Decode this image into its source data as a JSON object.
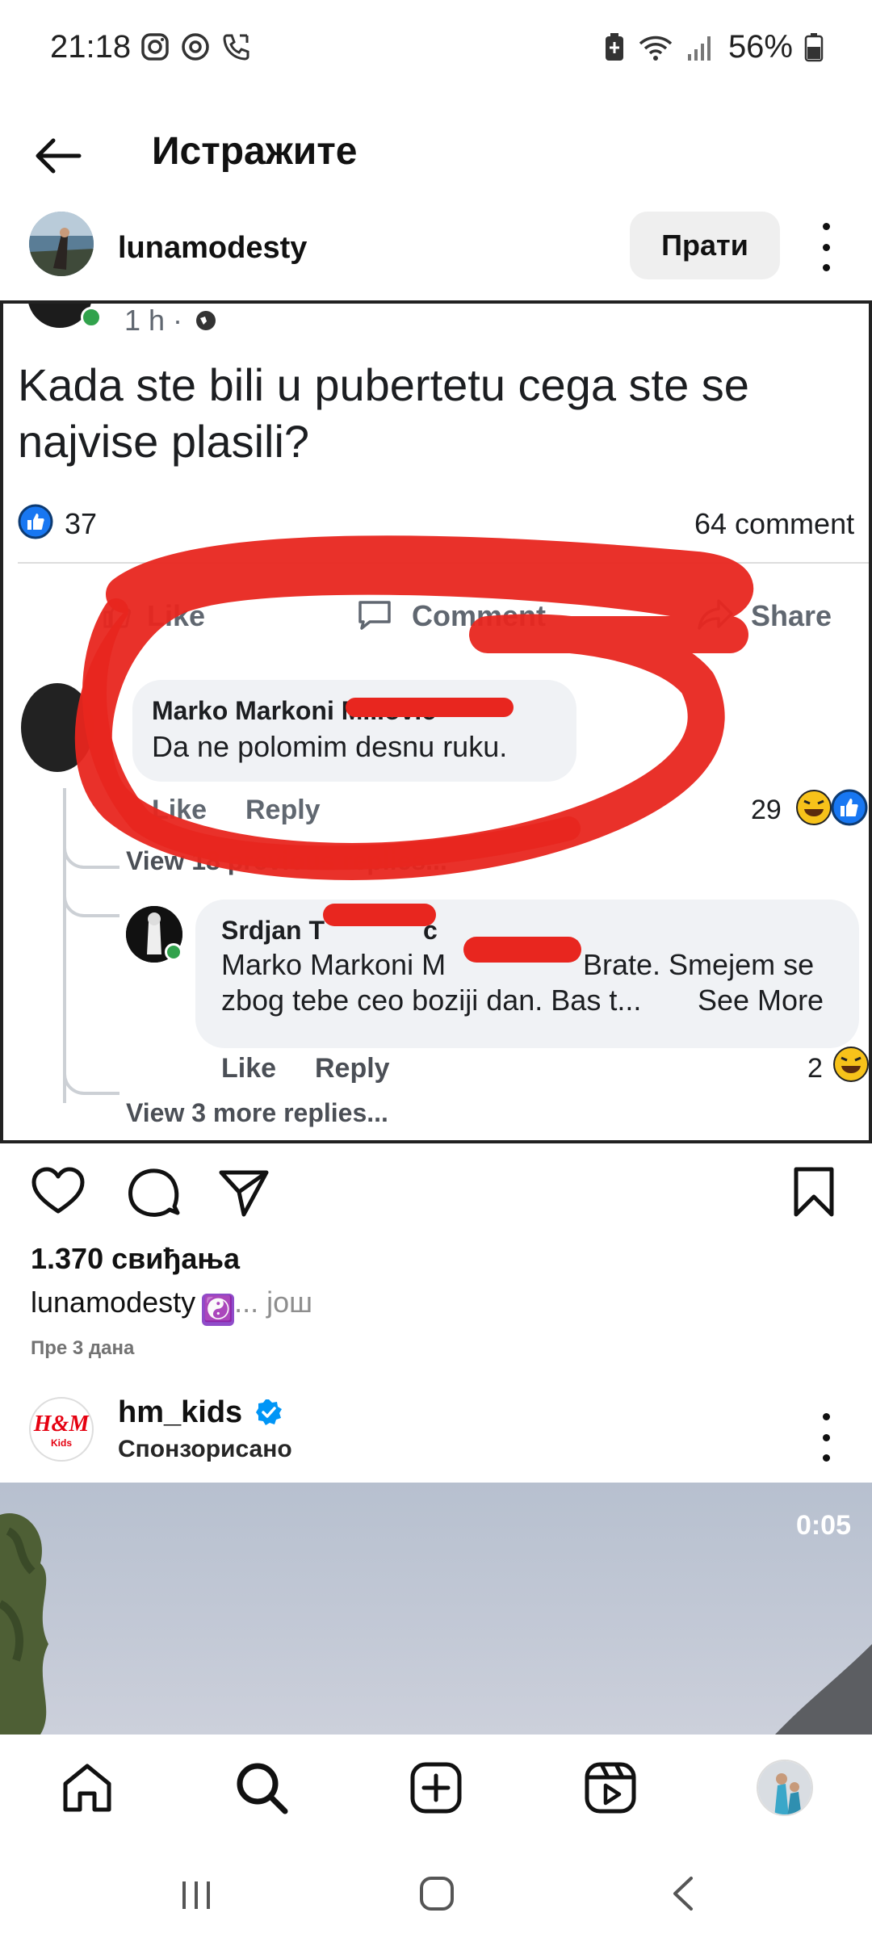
{
  "status_bar": {
    "time": "21:18",
    "battery": "56%",
    "left_icons": [
      "instagram-icon",
      "threads-icon",
      "phone-icon"
    ],
    "right_icons": [
      "battery-saver-icon",
      "wifi-icon",
      "signal-icon",
      "battery-icon"
    ]
  },
  "header": {
    "title": "Истражите"
  },
  "post": {
    "username": "lunamodesty",
    "follow_label": "Прати",
    "likes": "1.370 свиђања",
    "caption_user": "lunamodesty",
    "caption_emoji": "☯️",
    "caption_more": "... још",
    "date": "Пре 3 дана"
  },
  "screenshot": {
    "time": "1 h ·",
    "question": "Kada ste bili u pubertetu cega ste se najvise plasili?",
    "reaction_count": "37",
    "comments_count": "64 comment",
    "like_label": "Like",
    "comment_label": "Comment",
    "share_label": "Share",
    "c1_author": "Marko Markoni M...ovic",
    "c1_text": "Da ne polomim desnu ruku.",
    "c1_like": "Like",
    "c1_reply": "Reply",
    "c1_reactions": "29",
    "view_prev": "View 18 previous replies...",
    "c2_author": "Srdjan T",
    "c2_author_end": "c",
    "c2_line1_start": "Marko Markoni M",
    "c2_line1_end": "Brate. Smejem se",
    "c2_line2": "zbog tebe ceo boziji dan. Bas t...",
    "c2_see_more": "See More",
    "c2_like": "Like",
    "c2_reply": "Reply",
    "c2_reactions": "2",
    "view_more": "View 3 more replies..."
  },
  "sponsored": {
    "username": "hm_kids",
    "verified": true,
    "label": "Спонзорисано",
    "logo_text": "H&M",
    "logo_sub": "Kids",
    "duration": "0:05"
  },
  "nav": {
    "items": [
      "home-icon",
      "search-icon",
      "create-icon",
      "reels-icon",
      "profile-avatar"
    ]
  },
  "colors": {
    "accent_blue": "#0095f6",
    "facebook_blue": "#1877f2",
    "red_marker": "#e8261f",
    "secondary_text": "#737373"
  }
}
